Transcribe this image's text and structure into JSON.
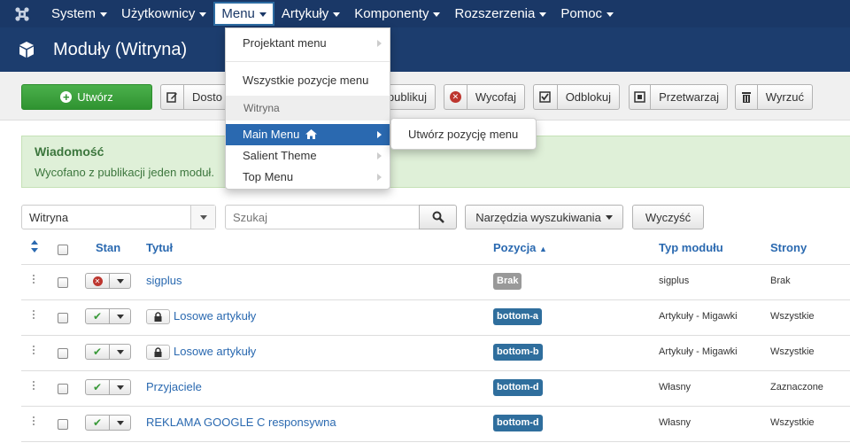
{
  "navbar": {
    "items": [
      {
        "label": "System"
      },
      {
        "label": "Użytkownicy"
      },
      {
        "label": "Menu"
      },
      {
        "label": "Artykuły"
      },
      {
        "label": "Komponenty"
      },
      {
        "label": "Rozszerzenia"
      },
      {
        "label": "Pomoc"
      }
    ],
    "logo_icon": "joomla-logo-icon"
  },
  "header": {
    "title": "Moduły (Witryna)",
    "icon": "cube-icon"
  },
  "toolbar": {
    "create_label": "Utwórz",
    "edit_label": "Dosto",
    "publish_label": "publikuj",
    "unpublish_label": "Wycofaj",
    "checkin_label": "Odblokuj",
    "batch_label": "Przetwarzaj",
    "trash_label": "Wyrzuć"
  },
  "message": {
    "title": "Wiadomość",
    "text": "Wycofano z publikacji jeden moduł."
  },
  "filters": {
    "client_value": "Witryna",
    "search_placeholder": "Szukaj",
    "tools_label": "Narzędzia wyszukiwania",
    "clear_label": "Wyczyść"
  },
  "table": {
    "headers": {
      "state": "Stan",
      "title": "Tytuł",
      "position": "Pozycja",
      "type": "Typ modułu",
      "pages": "Strony"
    },
    "rows": [
      {
        "state": "unpublished",
        "locked": false,
        "title": "sigplus",
        "position": "Brak",
        "position_style": "grey",
        "type": "sigplus",
        "pages": "Brak"
      },
      {
        "state": "published",
        "locked": true,
        "title": "Losowe artykuły",
        "position": "bottom-a",
        "position_style": "blue",
        "type": "Artykuły - Migawki",
        "pages": "Wszystkie"
      },
      {
        "state": "published",
        "locked": true,
        "title": "Losowe artykuły",
        "position": "bottom-b",
        "position_style": "blue",
        "type": "Artykuły - Migawki",
        "pages": "Wszystkie"
      },
      {
        "state": "published",
        "locked": false,
        "title": "Przyjaciele",
        "position": "bottom-d",
        "position_style": "blue",
        "type": "Własny",
        "pages": "Zaznaczone"
      },
      {
        "state": "published",
        "locked": false,
        "title": "REKLAMA GOOGLE C responsywna",
        "position": "bottom-d",
        "position_style": "blue",
        "type": "Własny",
        "pages": "Wszystkie"
      }
    ]
  },
  "menu_dropdown": {
    "manager_label": "Projektant menu",
    "all_items_label": "Wszystkie pozycje menu",
    "site_header": "Witryna",
    "menus": [
      {
        "label": "Main Menu",
        "home": true
      },
      {
        "label": "Salient Theme",
        "home": false
      },
      {
        "label": "Top Menu",
        "home": false
      }
    ],
    "submenu_label": "Utwórz pozycję menu"
  },
  "colors": {
    "navbar_bg": "#1a3867",
    "header_bg": "#1c3d6e",
    "create_green": "#2f9331",
    "link_blue": "#2a69b0",
    "badge_blue": "#2f6e9d",
    "alert_bg": "#dff0d8"
  }
}
